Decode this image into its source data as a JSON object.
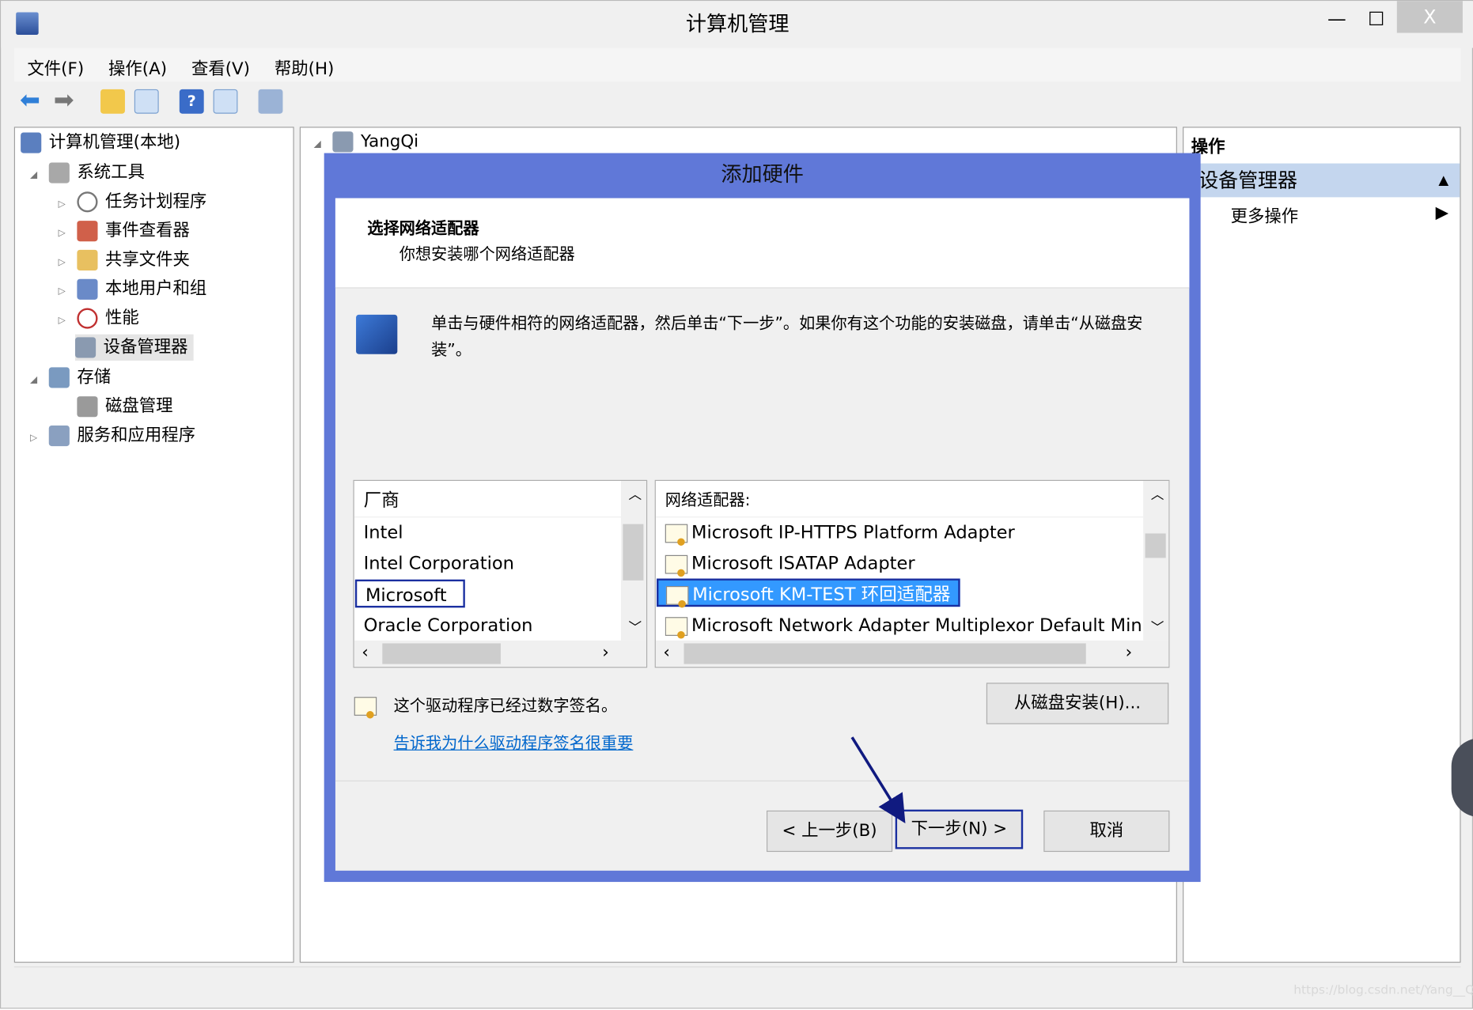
{
  "window": {
    "title": "计算机管理",
    "controls": {
      "minimize": "—",
      "maximize": "☐",
      "close": "X"
    }
  },
  "menu": [
    "文件(F)",
    "操作(A)",
    "查看(V)",
    "帮助(H)"
  ],
  "toolbar": [
    "back-icon",
    "forward-icon",
    "up-folder-icon",
    "show-hide-tree-icon",
    "help-icon",
    "action-pane-icon",
    "scan-hardware-icon"
  ],
  "tree": {
    "root": "计算机管理(本地)",
    "items": [
      {
        "label": "系统工具",
        "level": 1,
        "expanded": true
      },
      {
        "label": "任务计划程序",
        "level": 2
      },
      {
        "label": "事件查看器",
        "level": 2
      },
      {
        "label": "共享文件夹",
        "level": 2
      },
      {
        "label": "本地用户和组",
        "level": 2
      },
      {
        "label": "性能",
        "level": 2
      },
      {
        "label": "设备管理器",
        "level": 2,
        "selected": true
      },
      {
        "label": "存储",
        "level": 1,
        "expanded": true
      },
      {
        "label": "磁盘管理",
        "level": 2
      },
      {
        "label": "服务和应用程序",
        "level": 1
      }
    ]
  },
  "center": {
    "node": "YangQi"
  },
  "actions": {
    "header": "操作",
    "section": "设备管理器",
    "more": "更多操作"
  },
  "dialog": {
    "title": "添加硬件",
    "heading": "选择网络适配器",
    "subheading": "你想安装哪个网络适配器",
    "instruction": "单击与硬件相符的网络适配器，然后单击“下一步”。如果你有这个功能的安装磁盘，请单击“从磁盘安装”。",
    "manufacturer_header": "厂商",
    "manufacturers": [
      "Intel",
      "Intel Corporation",
      "Microsoft",
      "Oracle Corporation"
    ],
    "selected_manufacturer": "Microsoft",
    "adapter_header": "网络适配器:",
    "adapters": [
      "Microsoft IP-HTTPS Platform Adapter",
      "Microsoft ISATAP Adapter",
      "Microsoft KM-TEST 环回适配器",
      "Microsoft Network Adapter Multiplexor Default Mini"
    ],
    "selected_adapter": "Microsoft KM-TEST 环回适配器",
    "signed_text": "这个驱动程序已经过数字签名。",
    "signing_link": "告诉我为什么驱动程序签名很重要",
    "have_disk": "从磁盘安装(H)...",
    "back": "< 上一步(B)",
    "next": "下一步(N) >",
    "cancel": "取消",
    "accent": "#6078d8",
    "selection": "#3399ff"
  },
  "watermark": "https://blog.csdn.net/Yang__Qi"
}
